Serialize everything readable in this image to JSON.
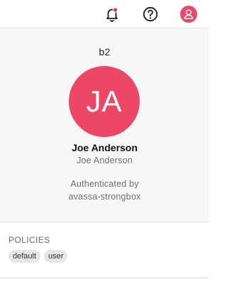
{
  "header": {
    "icons": [
      "bell-icon",
      "help-icon",
      "user-icon"
    ],
    "notification_dot_color": "#e8344f",
    "user_icon_bg": "#ee4766"
  },
  "profile": {
    "tenant": "b2",
    "avatar_initials": "JA",
    "avatar_color": "#ee4766",
    "display_name": "Joe Anderson",
    "username": "Joe Anderson",
    "auth_label": "Authenticated by",
    "auth_source": "avassa-strongbox"
  },
  "policies": {
    "title": "POLICIES",
    "items": [
      "default",
      "user"
    ]
  }
}
